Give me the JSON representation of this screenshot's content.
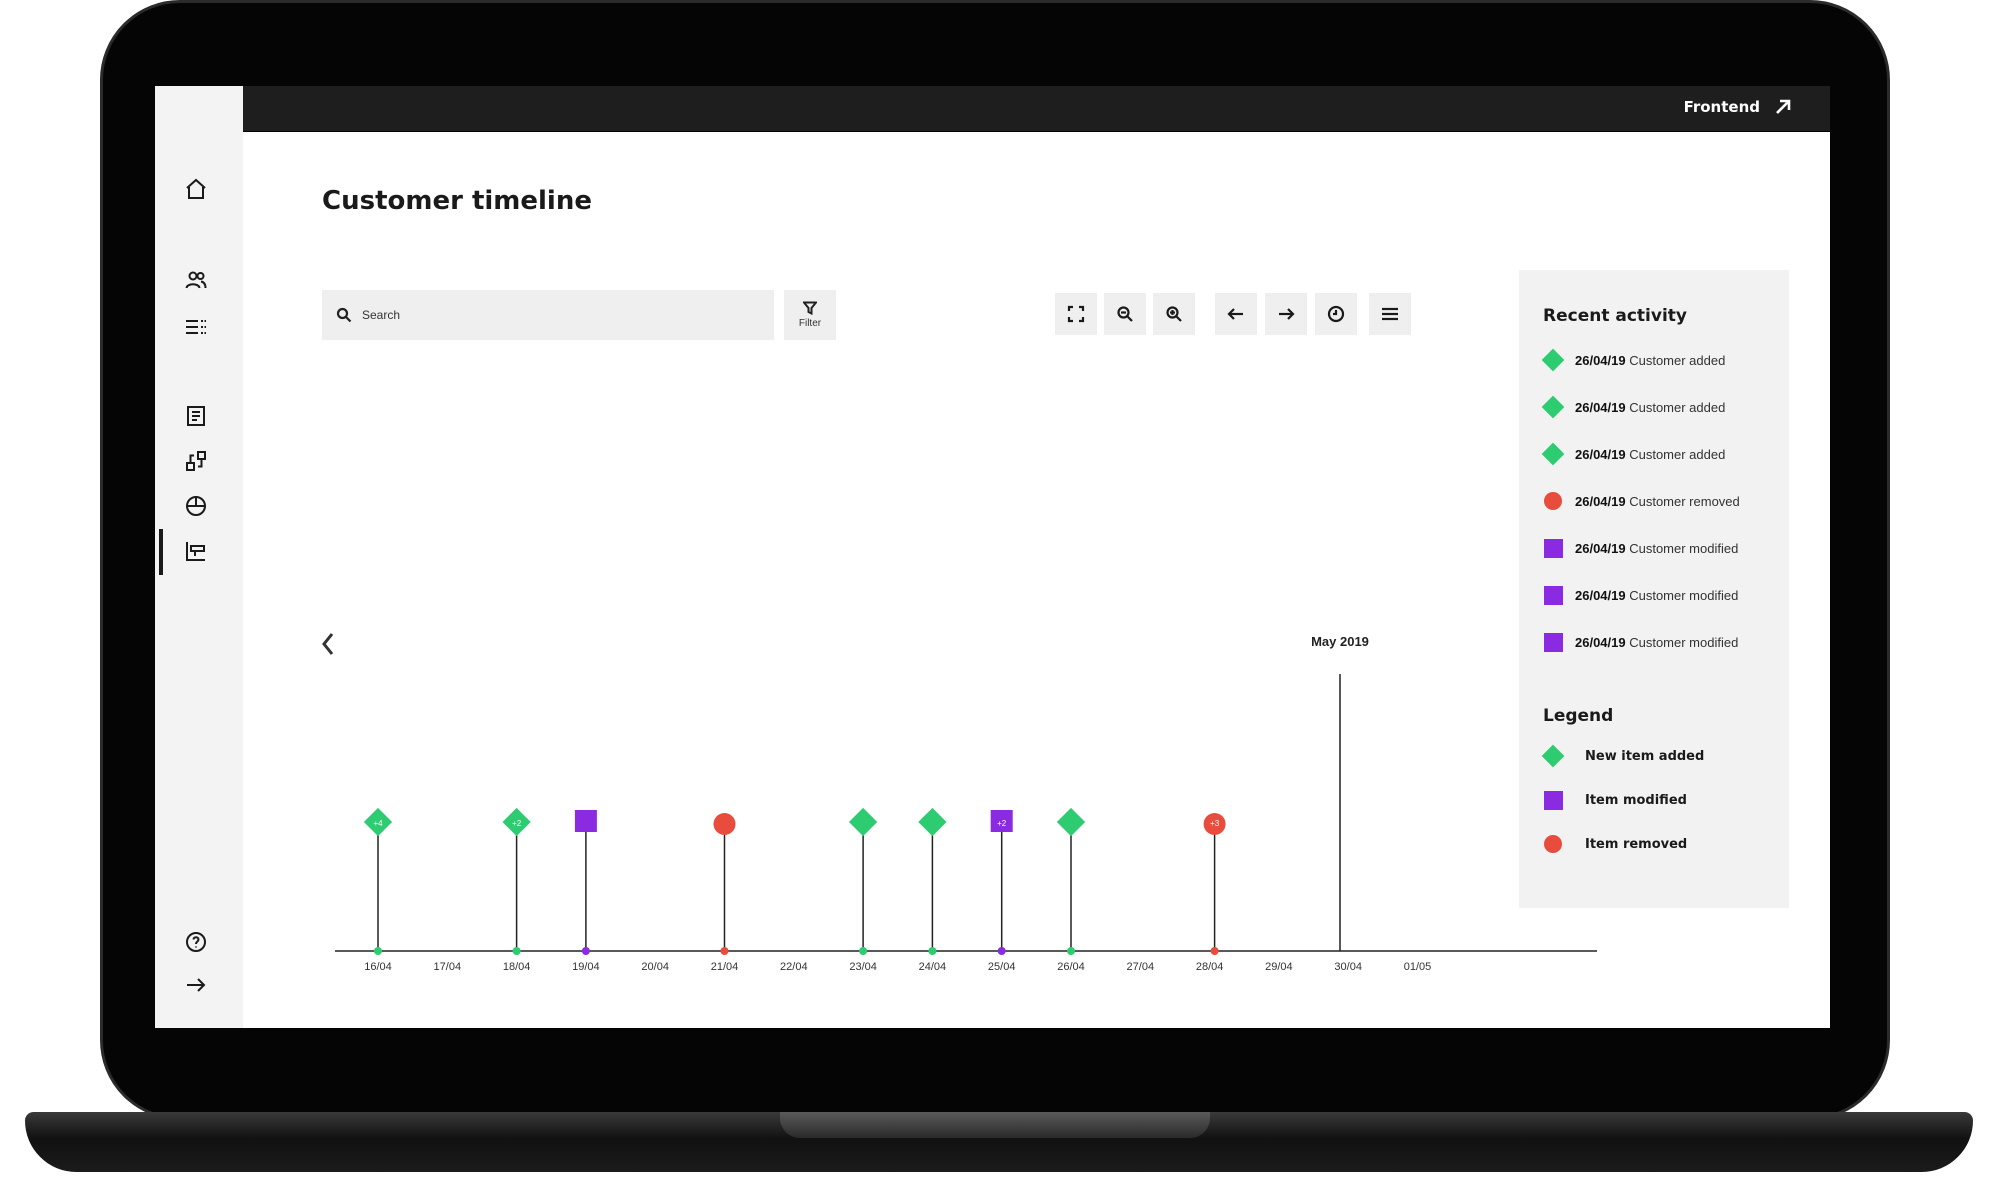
{
  "topbar": {
    "link_label": "Frontend",
    "link_icon": "arrow-up-right-icon"
  },
  "page": {
    "title": "Customer timeline"
  },
  "sidebar": {
    "items": [
      {
        "icon": "home-icon"
      },
      {
        "icon": "users-icon"
      },
      {
        "icon": "list-icon"
      },
      {
        "icon": "document-icon"
      },
      {
        "icon": "nodes-icon"
      },
      {
        "icon": "pie-icon"
      },
      {
        "icon": "timeline-icon",
        "active": true
      },
      {
        "icon": "help-icon"
      },
      {
        "icon": "logout-arrow-icon"
      }
    ]
  },
  "toolbar": {
    "search_placeholder": "Search",
    "filter_label": "Filter",
    "buttons": [
      "fullscreen-icon",
      "zoom-out-icon",
      "zoom-in-icon",
      "arrow-left-icon",
      "arrow-right-icon",
      "clock-icon",
      "menu-icon"
    ]
  },
  "colors": {
    "added": "#2ecc71",
    "modified": "#8a2be2",
    "removed": "#e74c3c",
    "topbar": "#1e1e1e"
  },
  "chart_data": {
    "type": "scatter",
    "title": "",
    "marker_label": "May 2019",
    "x_ticks": [
      "16/04",
      "17/04",
      "18/04",
      "19/04",
      "20/04",
      "21/04",
      "22/04",
      "23/04",
      "24/04",
      "25/04",
      "26/04",
      "27/04",
      "28/04",
      "29/04",
      "30/04",
      "01/05"
    ],
    "events": [
      {
        "date": "16/04",
        "kind": "added",
        "badge": "+4"
      },
      {
        "date": "18/04",
        "kind": "added",
        "badge": "+2"
      },
      {
        "date": "19/04",
        "kind": "modified",
        "badge": ""
      },
      {
        "date": "21/04",
        "kind": "removed",
        "badge": ""
      },
      {
        "date": "23/04",
        "kind": "added",
        "badge": ""
      },
      {
        "date": "24/04",
        "kind": "added",
        "badge": ""
      },
      {
        "date": "25/04",
        "kind": "modified",
        "badge": "+2"
      },
      {
        "date": "26/04",
        "kind": "added",
        "badge": ""
      },
      {
        "date": "28/04",
        "kind": "removed",
        "badge": "+3"
      }
    ]
  },
  "recent_activity": {
    "title": "Recent activity",
    "items": [
      {
        "kind": "added",
        "date": "26/04/19",
        "text": "Customer added"
      },
      {
        "kind": "added",
        "date": "26/04/19",
        "text": "Customer added"
      },
      {
        "kind": "added",
        "date": "26/04/19",
        "text": "Customer added"
      },
      {
        "kind": "removed",
        "date": "26/04/19",
        "text": "Customer removed"
      },
      {
        "kind": "modified",
        "date": "26/04/19",
        "text": "Customer modified"
      },
      {
        "kind": "modified",
        "date": "26/04/19",
        "text": "Customer modified"
      },
      {
        "kind": "modified",
        "date": "26/04/19",
        "text": "Customer modified"
      }
    ]
  },
  "legend": {
    "title": "Legend",
    "items": [
      {
        "kind": "added",
        "label": "New item added"
      },
      {
        "kind": "modified",
        "label": "Item modified"
      },
      {
        "kind": "removed",
        "label": "Item removed"
      }
    ]
  }
}
